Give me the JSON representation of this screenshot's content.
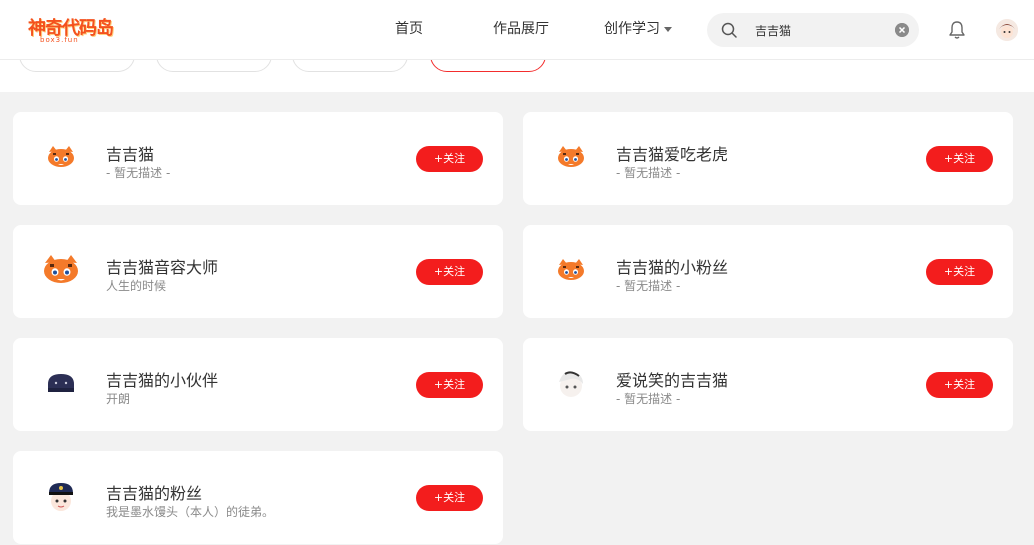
{
  "header": {
    "logo_text": "神奇代码岛",
    "logo_sub": "box3.fun",
    "nav": [
      "首页",
      "作品展厅",
      "创作学习"
    ],
    "search": {
      "value": "吉吉猫",
      "placeholder": ""
    }
  },
  "tabs": [
    "",
    "",
    "",
    ""
  ],
  "results": [
    {
      "name": "吉吉猫",
      "desc": "- 暂无描述 -",
      "follow_label": "+关注",
      "avatar": "tiger"
    },
    {
      "name": "吉吉猫爱吃老虎",
      "desc": "- 暂无描述 -",
      "follow_label": "+关注",
      "avatar": "tiger"
    },
    {
      "name": "吉吉猫音容大师",
      "desc": "人生的时候",
      "follow_label": "+关注",
      "avatar": "tiger-big"
    },
    {
      "name": "吉吉猫的小粉丝",
      "desc": "- 暂无描述 -",
      "follow_label": "+关注",
      "avatar": "tiger"
    },
    {
      "name": "吉吉猫的小伙伴",
      "desc": "开朗",
      "follow_label": "+关注",
      "avatar": "navy-cap"
    },
    {
      "name": "爱说笑的吉吉猫",
      "desc": "- 暂无描述 -",
      "follow_label": "+关注",
      "avatar": "white-hair"
    },
    {
      "name": "吉吉猫的粉丝",
      "desc": "我是墨水馒头（本人）的徒弟。",
      "follow_label": "+关注",
      "avatar": "police-cap"
    }
  ],
  "colors": {
    "accent": "#f31d1d",
    "background": "#f2f2f2",
    "tiger": "#f47a2a"
  },
  "icons": [
    "search-icon",
    "clear-icon",
    "bell-icon",
    "caret-down-icon"
  ]
}
